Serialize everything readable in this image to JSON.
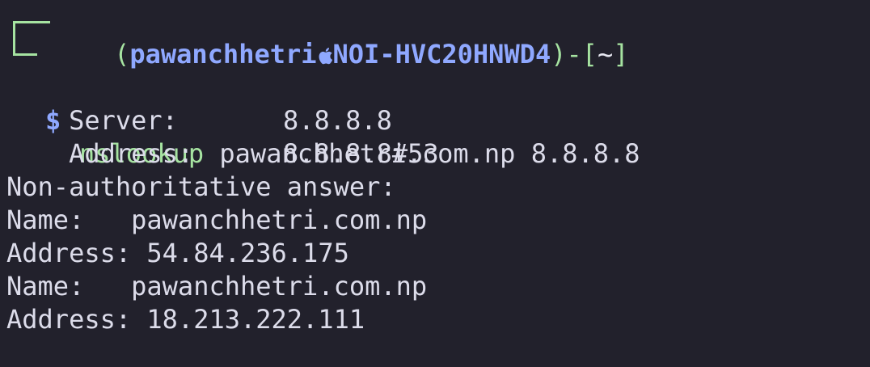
{
  "prompt": {
    "open_paren": "(",
    "user": "pawanchhetri",
    "host": "NOI-HVC20HNWD4",
    "close_paren": ")",
    "dash": "-",
    "dir_open": "[",
    "dir": "~",
    "dir_close": "]",
    "symbol": "$",
    "command": "nslookup",
    "args": "pawanchhetri.com.np 8.8.8.8"
  },
  "output": {
    "server_label": "Server:",
    "server_value": "8.8.8.8",
    "address_label": "Address:",
    "address_value": "8.8.8.8#53",
    "non_auth": "Non-authoritative answer:",
    "records": [
      {
        "label": "Name:",
        "value": "pawanchhetri.com.np"
      },
      {
        "label": "Address:",
        "value": "54.84.236.175"
      },
      {
        "label": "Name:",
        "value": "pawanchhetri.com.np"
      },
      {
        "label": "Address:",
        "value": "18.213.222.111"
      }
    ]
  },
  "colors": {
    "background": "#22212c",
    "prompt_green": "#a6e3a1",
    "prompt_blue": "#8fa8ff",
    "text": "#dcdcea"
  },
  "icons": {
    "host_separator": "apple-icon"
  }
}
